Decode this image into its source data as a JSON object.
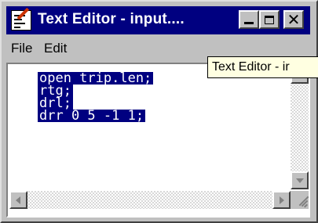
{
  "window": {
    "title": "Text Editor - input....",
    "icon": "text-editor-icon",
    "controls": {
      "minimize": "minimize-icon",
      "maximize": "maximize-icon",
      "close": "✕"
    }
  },
  "menu": {
    "items": [
      "File",
      "Edit"
    ]
  },
  "editor": {
    "lines": [
      "open trip.len;",
      "rtg;",
      "drl;",
      "drr 0 5 -1 1;"
    ],
    "selection_color": "#000080"
  },
  "tooltip": {
    "text": "Text Editor - ir"
  }
}
